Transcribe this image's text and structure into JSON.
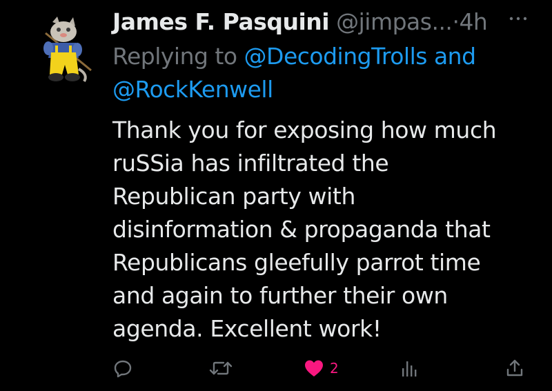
{
  "author": {
    "display_name": "James F. Pasquini",
    "handle": "@jimpas...",
    "separator": "·",
    "time": "4h",
    "avatar_icon": "cartoon-cat-fishing-avatar"
  },
  "more_icon": "more-horizontal-icon",
  "reply_to": {
    "prefix": "Replying to",
    "mention_1": "@DecodingTrolls",
    "conjunction": "and",
    "mention_2": "@RockKenwell"
  },
  "body_lines": [
    "Thank you for exposing how much",
    "ruSSia has infiltrated the",
    "Republican party with",
    "disinformation & propaganda that",
    "Republicans gleefully parrot time",
    "and again to further their own",
    "agenda. Excellent work!"
  ],
  "actions": {
    "reply_icon": "reply-icon",
    "retweet_icon": "retweet-icon",
    "like_icon": "heart-filled-icon",
    "like_count": "2",
    "views_icon": "analytics-icon",
    "share_icon": "share-icon"
  },
  "colors": {
    "background": "#000000",
    "text_primary": "#e7e9ea",
    "text_secondary": "#71767b",
    "link": "#1d9bf0",
    "like": "#f91880"
  }
}
